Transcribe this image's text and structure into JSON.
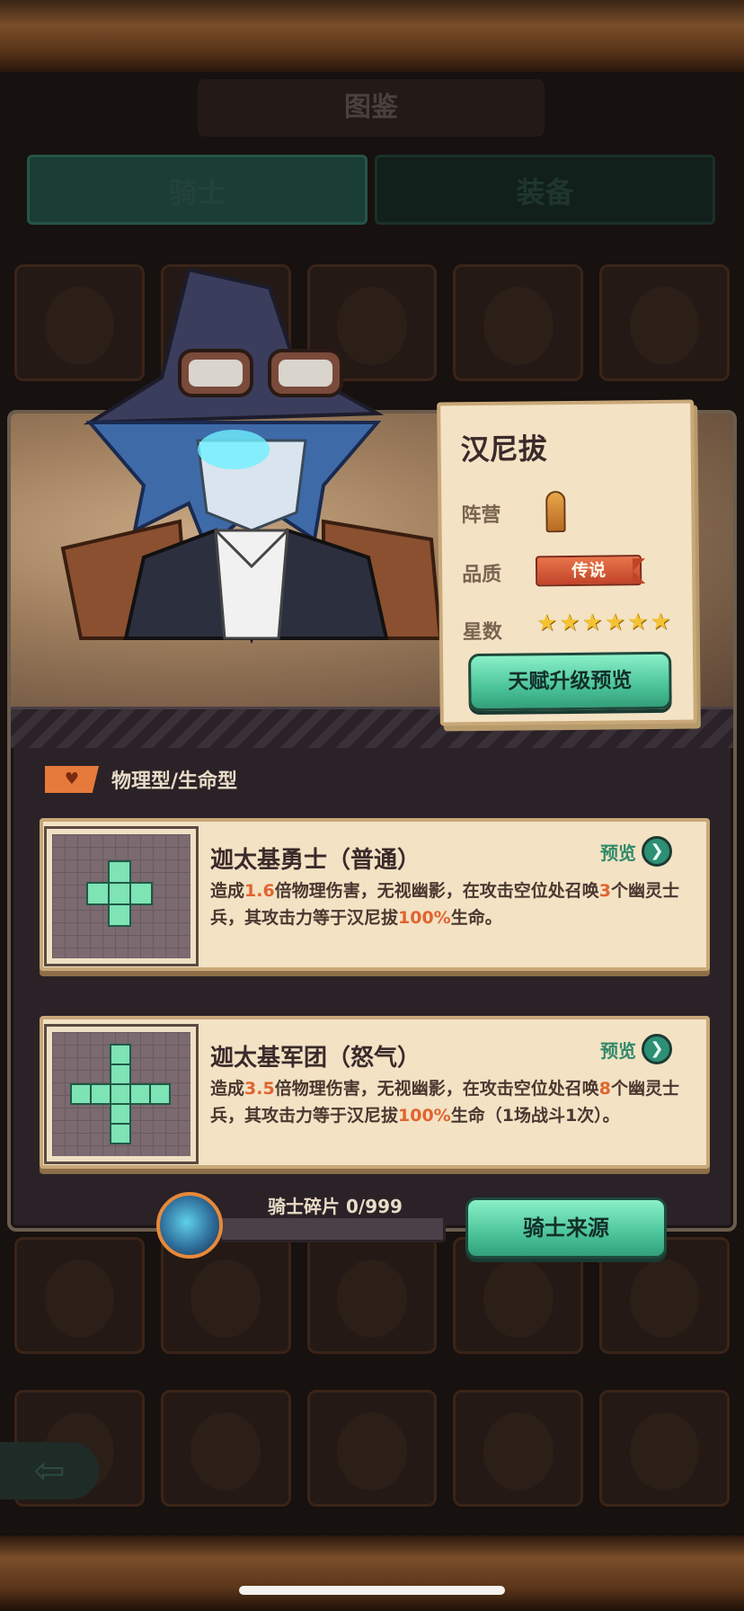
{
  "page": {
    "title": "图鉴",
    "tabs": [
      {
        "label": "骑士",
        "active": true
      },
      {
        "label": "装备",
        "active": false
      }
    ]
  },
  "hero": {
    "name": "汉尼拔",
    "camp_label": "阵营",
    "camp_icon": "bullet-icon",
    "quality_label": "品质",
    "quality_value": "传说",
    "stars_label": "星数",
    "stars": 6,
    "star_glyph": "★",
    "talent_button": "天赋升级预览",
    "type_text": "物理型/生命型",
    "type_icon": "heart-plus-icon"
  },
  "skills": [
    {
      "name": "迦太基勇士（普通）",
      "preview": "预览",
      "desc_parts": [
        "造成",
        "1.6",
        "倍物理伤害，无视幽影，在攻击空位处召唤",
        "3",
        "个幽灵士兵，其攻击力等于汉尼拔",
        "100%",
        "生命。"
      ],
      "shape": "small-cross"
    },
    {
      "name": "迦太基军团（怒气）",
      "preview": "预览",
      "desc_parts": [
        "造成",
        "3.5",
        "倍物理伤害，无视幽影，在攻击空位处召唤",
        "8",
        "个幽灵士兵，其攻击力等于汉尼拔",
        "100%",
        "生命（1场战斗1次）。"
      ],
      "shape": "big-cross"
    }
  ],
  "shards": {
    "label": "骑士碎片",
    "count": "0/999",
    "progress": 0
  },
  "source_button": "骑士来源",
  "back_icon": "back-arrow-icon",
  "colors": {
    "green_button": "#4cc49a",
    "highlight": "#e0642f",
    "star": "#f5c232",
    "quality": "#c2432a"
  }
}
